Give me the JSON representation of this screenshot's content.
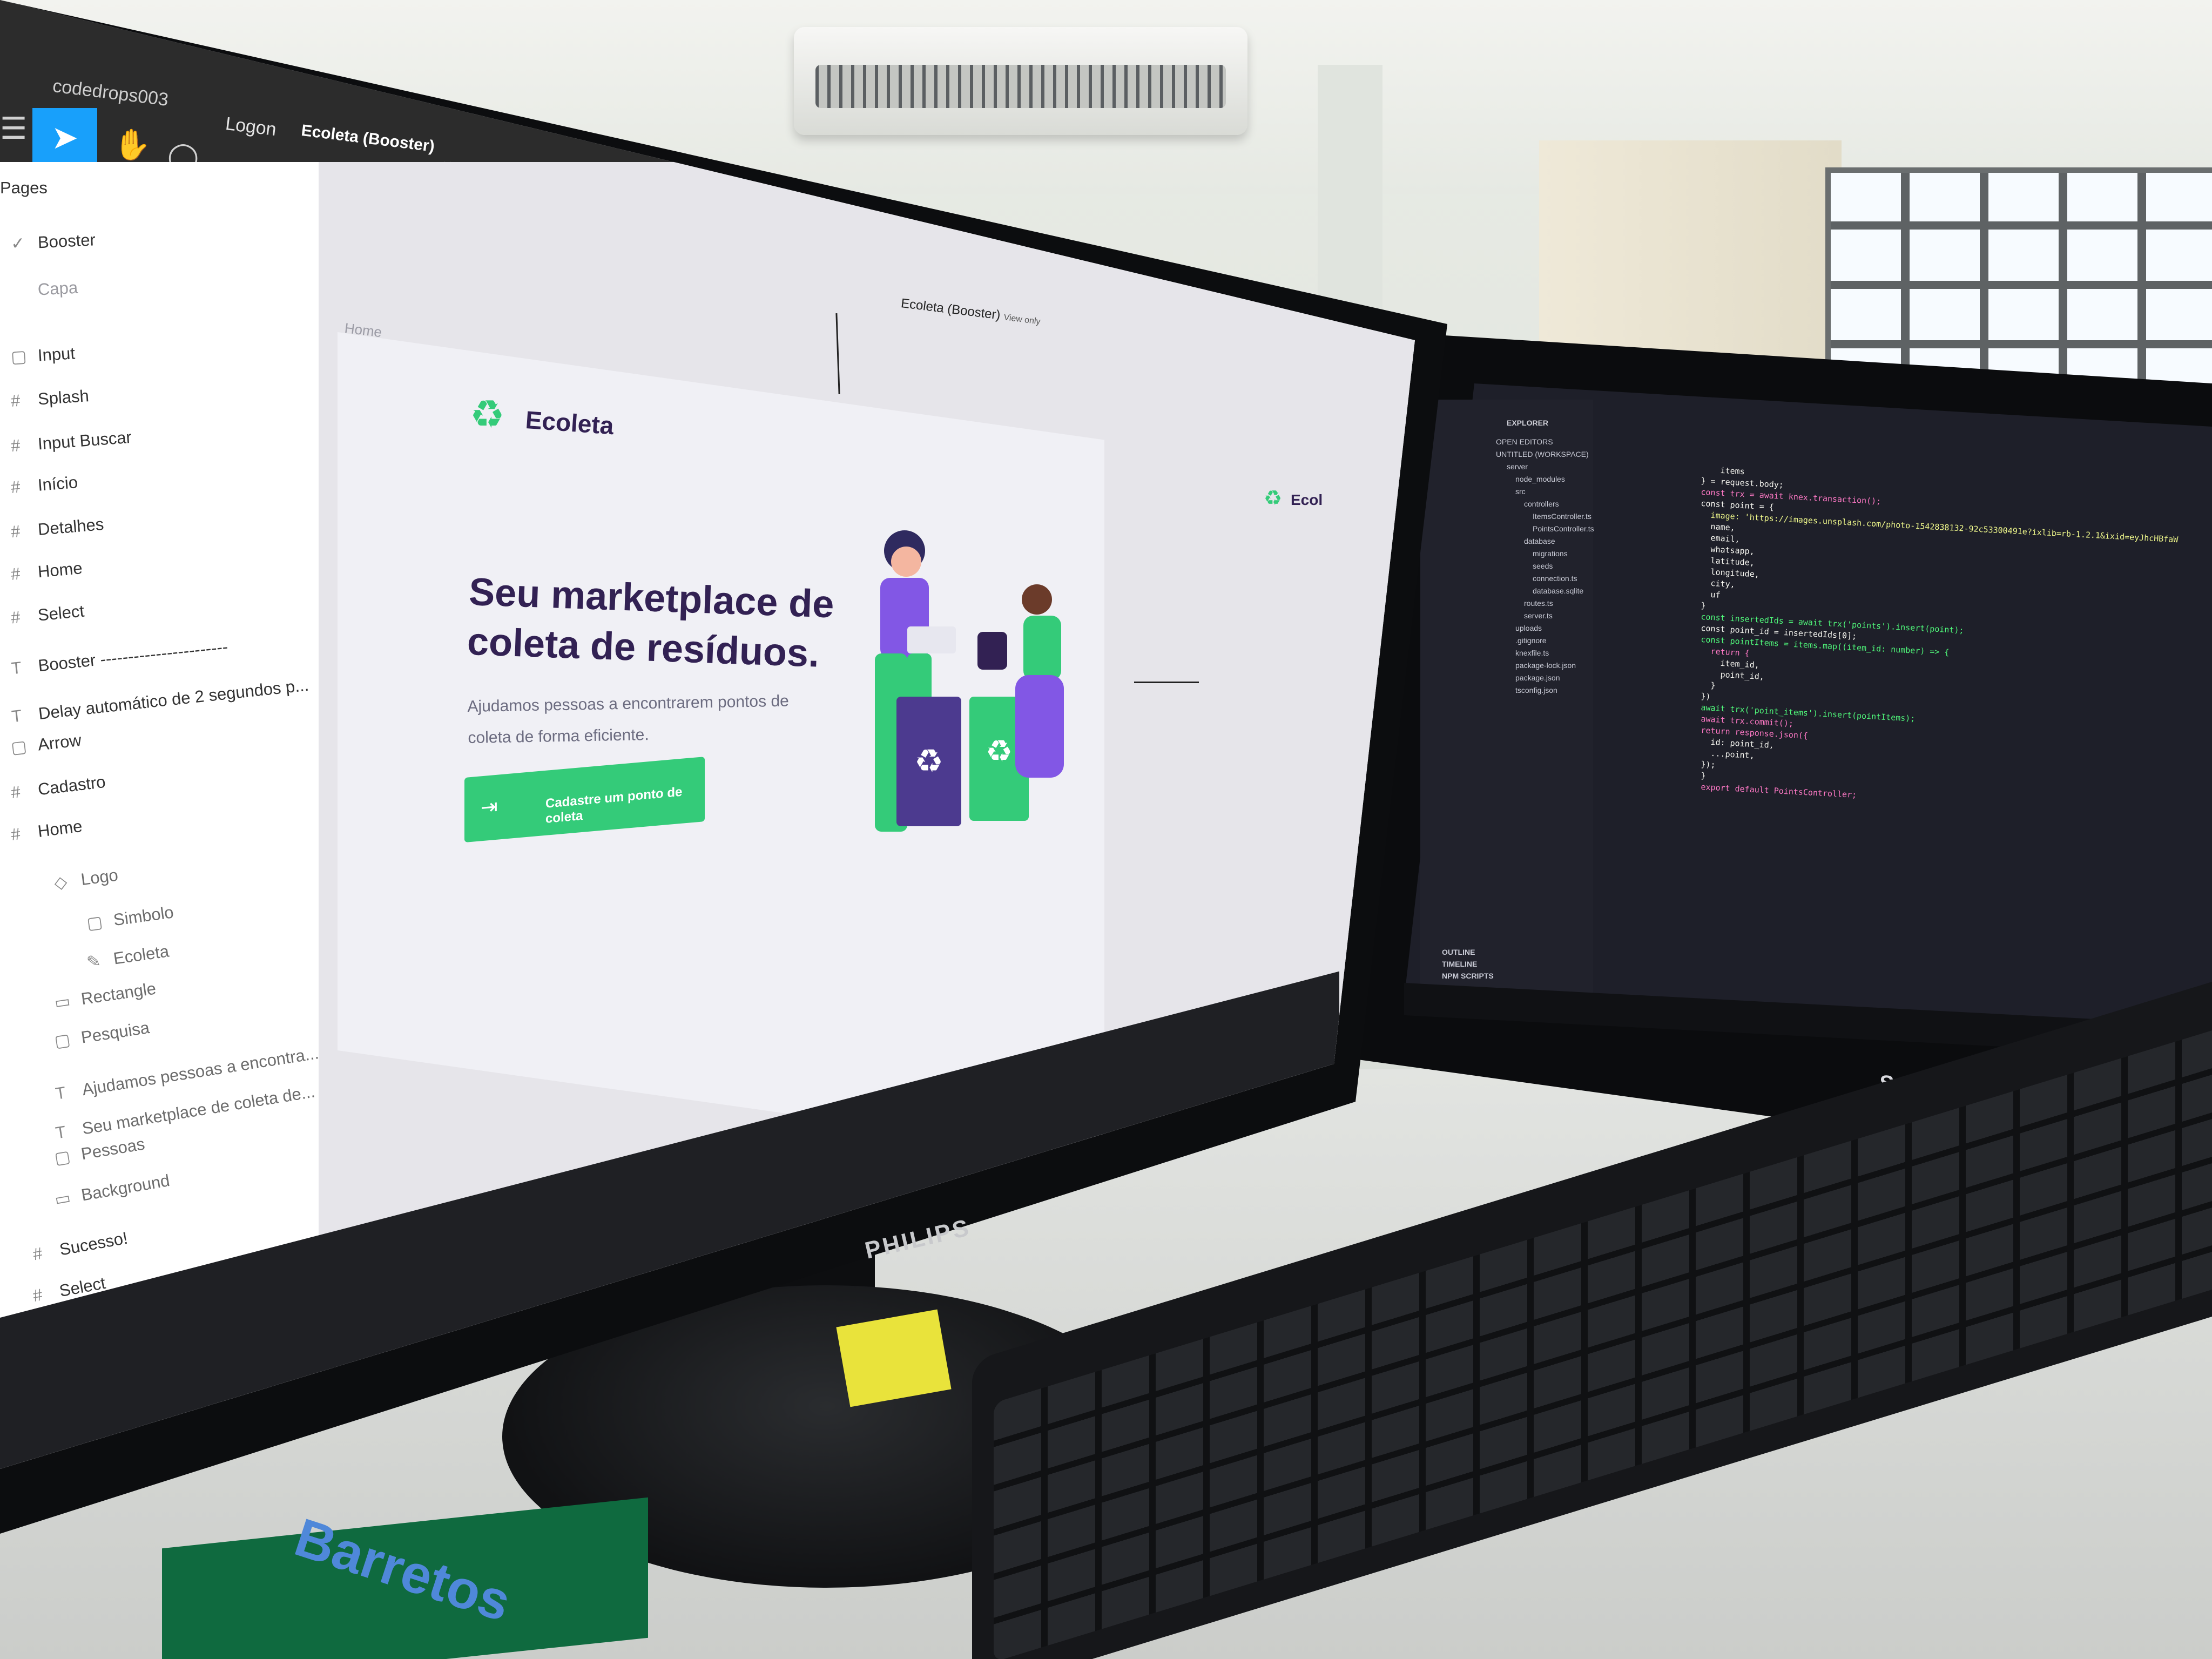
{
  "figma": {
    "file_name": "codedrops003",
    "tabs": {
      "logon": "Logon",
      "active": "Ecoleta (Booster)"
    },
    "tab_close": "×",
    "tab_add": "+",
    "layers_header": "Pages",
    "pages": [
      "Booster",
      "Capa"
    ],
    "layers": [
      "Input",
      "Splash",
      "Input Buscar",
      "Início",
      "Detalhes",
      "Home",
      "Select",
      "Booster -----------------------",
      "Delay automático de 2 segundos p...",
      "Arrow",
      "Cadastro",
      "Home"
    ],
    "home_children": [
      "Logo",
      "Simbolo",
      "Ecoleta",
      "Rectangle",
      "Pesquisa",
      "Ajudamos pessoas a encontra...",
      "Seu marketplace de coleta de...",
      "Pessoas",
      "Background"
    ],
    "bottom_layers": [
      "Sucesso!",
      "Select"
    ],
    "frame_label": "Ecoleta (Booster)",
    "frame_label_suffix": "View only",
    "home_frame_label": "Home",
    "colors": {
      "topbar": "#2c2c2c",
      "move_tool": "#18a0fb",
      "panel": "#ffffff"
    }
  },
  "ecoleta": {
    "logo": "Ecoleta",
    "title": "Seu marketplace de coleta de resíduos.",
    "subtitle": "Ajudamos pessoas a encontrarem pontos de coleta de forma eficiente.",
    "button_label": "Cadastre um ponto de coleta",
    "mini_logo": "Ecol",
    "colors": {
      "primary": "#34cb79",
      "title": "#322153",
      "text": "#6c6c80"
    }
  },
  "vscode": {
    "explorer_title": "EXPLORER",
    "tree": [
      "OPEN EDITORS",
      "UNTITLED (WORKSPACE)",
      "server",
      "node_modules",
      "src",
      "controllers",
      "ItemsController.ts",
      "PointsController.ts",
      "database",
      "migrations",
      "seeds",
      "connection.ts",
      "database.sqlite",
      "routes.ts",
      "server.ts",
      "uploads",
      ".gitignore",
      "knexfile.ts",
      "package-lock.json",
      "package.json",
      "tsconfig.json"
    ],
    "footer": [
      "OUTLINE",
      "TIMELINE",
      "NPM SCRIPTS"
    ],
    "code": [
      {
        "kind": "plain",
        "text": "    items"
      },
      {
        "kind": "plain",
        "text": "} = request.body;"
      },
      {
        "kind": "kw",
        "text": "const trx = await knex.transaction();"
      },
      {
        "kind": "plain",
        "text": "const point = {"
      },
      {
        "kind": "str",
        "text": "  image: 'https://images.unsplash.com/photo-1542838132-92c53300491e?ixlib=rb-1.2.1&ixid=eyJhcHBfaW"
      },
      {
        "kind": "plain",
        "text": "  name,"
      },
      {
        "kind": "plain",
        "text": "  email,"
      },
      {
        "kind": "plain",
        "text": "  whatsapp,"
      },
      {
        "kind": "plain",
        "text": "  latitude,"
      },
      {
        "kind": "plain",
        "text": "  longitude,"
      },
      {
        "kind": "plain",
        "text": "  city,"
      },
      {
        "kind": "plain",
        "text": "  uf"
      },
      {
        "kind": "plain",
        "text": "}"
      },
      {
        "kind": "fn",
        "text": "const insertedIds = await trx('points').insert(point);"
      },
      {
        "kind": "plain",
        "text": "const point_id = insertedIds[0];"
      },
      {
        "kind": "fn",
        "text": "const pointItems = items.map((item_id: number) => {"
      },
      {
        "kind": "kw",
        "text": "  return {"
      },
      {
        "kind": "plain",
        "text": "    item_id,"
      },
      {
        "kind": "plain",
        "text": "    point_id,"
      },
      {
        "kind": "plain",
        "text": "  }"
      },
      {
        "kind": "plain",
        "text": "})"
      },
      {
        "kind": "fn",
        "text": "await trx('point_items').insert(pointItems);"
      },
      {
        "kind": "kw",
        "text": "await trx.commit();"
      },
      {
        "kind": "kw",
        "text": "return response.json({"
      },
      {
        "kind": "plain",
        "text": "  id: point_id,"
      },
      {
        "kind": "plain",
        "text": "  ...point,"
      },
      {
        "kind": "plain",
        "text": "});"
      },
      {
        "kind": "plain",
        "text": "}"
      },
      {
        "kind": "kw",
        "text": "export default PointsController;"
      }
    ]
  },
  "hardware": {
    "left_monitor_brand": "PHILIPS",
    "right_monitor_brand": "SAMSUNG",
    "book_text": "Barretos"
  },
  "icons": {
    "menu": "menu-icon",
    "move": "cursor-icon",
    "hand": "hand-icon",
    "comment": "comment-icon",
    "recycle": "recycle-icon",
    "login": "enter-icon",
    "frame": "hash-icon",
    "text": "text-icon",
    "start": "windows-start-icon"
  }
}
